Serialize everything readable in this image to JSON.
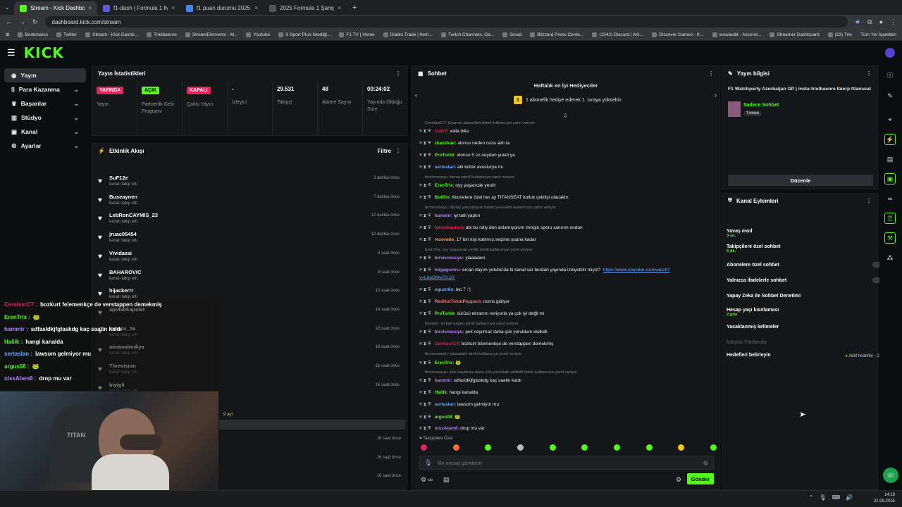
{
  "browser": {
    "tabs": [
      {
        "title": "Stream - Kick Dashboard",
        "color": "#53fc18"
      },
      {
        "title": "f1-dash | Formula 1 live timing",
        "color": "#5b5bd6"
      },
      {
        "title": "f1 puan durumu 2025 - Google",
        "color": "#4285f4"
      },
      {
        "title": "2025 Formula 1 Şampiyonası Yarış",
        "color": "#555555"
      }
    ],
    "url": "dashboard.kick.com/stream",
    "bookmarks": [
      "Bookmarks",
      "Twitter",
      "Stream - Kick Dashb...",
      "Trielbaenre",
      "StreamElements - M...",
      "Youtube",
      "S Sport Plus-İstediği...",
      "F1 TV | Home",
      "Diablo Trade | Item...",
      "Twitch Channels, Ga...",
      "Gmail",
      "Blizzard Press Cente...",
      "(1342) Discord | Ark...",
      "Discover Games - K...",
      "wowaudit - Ascend...",
      "Streamer Dashboard",
      "(23) Trielbaenre - Yo..."
    ],
    "all_bookmarks": "Tüm Yer İşaretleri"
  },
  "logo": "KICK",
  "sidebar": {
    "items": [
      {
        "label": "Yayın",
        "icon": "stream-icon"
      },
      {
        "label": "Para Kazanma",
        "icon": "dollar-icon"
      },
      {
        "label": "Başarılar",
        "icon": "trophy-icon"
      },
      {
        "label": "Stüdyo",
        "icon": "studio-icon"
      },
      {
        "label": "Kanal",
        "icon": "channel-icon"
      },
      {
        "label": "Ayarlar",
        "icon": "gear-icon"
      }
    ]
  },
  "stats": {
    "title": "Yayın İstatistikleri",
    "cells": [
      {
        "value": "YAYINDA",
        "label": "Yayın",
        "badge": "#e0245e"
      },
      {
        "value": "AÇIK",
        "label": "Partnerlik Gelir Programı",
        "badge": "#53fc18"
      },
      {
        "value": "KAPALI",
        "label": "Çoklu Yayın",
        "badge": "#e0245e"
      },
      {
        "value": "-",
        "label": "İzleyici"
      },
      {
        "value": "29.531",
        "label": "Takipçi"
      },
      {
        "value": "48",
        "label": "Abone Sayısı"
      },
      {
        "value": "00:24:02",
        "label": "Yayında Olduğu Süre"
      }
    ]
  },
  "activity": {
    "title": "Etkinlik Akışı",
    "filter": "Filtre",
    "events": [
      {
        "name": "SuF12e",
        "sub": "kanalı takip etti",
        "time": "3 dakika önce"
      },
      {
        "name": "Buseaynen",
        "sub": "kanalı takip etti",
        "time": "7 dakika önce"
      },
      {
        "name": "LebRonCAYMIS_23",
        "sub": "kanalı takip etti",
        "time": "12 dakika önce"
      },
      {
        "name": "jruac05454",
        "sub": "kanalı takip etti",
        "time": "12 dakika önce"
      },
      {
        "name": "Vividazai",
        "sub": "kanalı takip etti",
        "time": "4 saat önce"
      },
      {
        "name": "BAHAROVIC",
        "sub": "kanalı takip etti",
        "time": "8 saat önce"
      },
      {
        "name": "hijackerrr",
        "sub": "kanalı takip etti",
        "time": "10 saat önce"
      },
      {
        "name": "apolatikapolet",
        "sub": "",
        "time": "14 saat önce"
      },
      {
        "name": "iremsu_16",
        "sub": "kanalı takip etti",
        "time": "16 saat önce"
      },
      {
        "name": "aimanaimdiya",
        "sub": "kanalı takip etti",
        "time": "16 saat önce"
      },
      {
        "name": "Threvision",
        "sub": "kanalı takip etti",
        "time": "16 saat önce"
      },
      {
        "name": "biyigli",
        "sub": "kanalı takip etti",
        "time": "16 saat önce"
      }
    ],
    "extra_times": [
      "16 saat önce",
      "16 saat önce",
      "16 saat önce",
      "16 saat önce"
    ],
    "months": "9 ay!"
  },
  "overlay_chat": [
    {
      "user": "CerelaxrC7 :",
      "msg": "bozkurt felemenkçe de verstappen demekmiş",
      "color": "#e0245e"
    },
    {
      "user": "ErenTrix :",
      "msg": "🐸",
      "color": "#53fc18"
    },
    {
      "user": "hammir :",
      "msg": "sdfasldkjfglaskdg kaç saatin kaldı",
      "color": "#b57cff"
    },
    {
      "user": "Halilk :",
      "msg": "hangi kanalda",
      "color": "#53fc18"
    },
    {
      "user": "sertaslan :",
      "msg": "lawsom gelmiyor mu",
      "color": "#6ba8ff"
    },
    {
      "user": "argus08 :",
      "msg": "🐸",
      "color": "#53fc18"
    },
    {
      "user": "nissAben8 :",
      "msg": "drop mu var",
      "color": "#b57cff"
    }
  ],
  "chat": {
    "title": "Sohbet",
    "gifter_title": "Haftalık en İyi Hediyeciler",
    "gifter_rank": "1",
    "gifter_text": "1 abonelik hediye ederek 1. sıraya yükseltin",
    "lines": [
      {
        "type": "reply",
        "text": "CerelaxrC7: kıyamet alametleri isimli kullanıcıya yanıt veriyor"
      },
      {
        "type": "msg",
        "user": "ztatz7",
        "msg": "valla bilia",
        "color": "#e0245e"
      },
      {
        "type": "msg",
        "user": "zkanzkan",
        "msg": "alonso neden ceza aldı ta",
        "color": "#53fc18"
      },
      {
        "type": "msg",
        "user": "ProTurkk",
        "msg": "alonso 5 sn neyden yuedi ya",
        "color": "#53fc18"
      },
      {
        "type": "msg",
        "user": "sertaslan",
        "msg": "abi kütük avusturya mı",
        "color": "#6ba8ff"
      },
      {
        "type": "reply",
        "text": "birvisnesuyu: borsa isimli kullanıcıya yanıt veriyor"
      },
      {
        "type": "msg",
        "user": "ErenTrix",
        "msg": "oyy yaşancak yerdir",
        "color": "#53fc18"
      },
      {
        "type": "msg",
        "user": "BotRix",
        "msg": "Abonelere özel her ay TITANSEAT koltuk çekilişi olacaktır.",
        "color": "#53fc18"
      },
      {
        "type": "reply",
        "text": "birvisnesuyu: dünüş yolundayım balım yea isimli kullanıcıya yanıt veriyor"
      },
      {
        "type": "msg",
        "user": "hammir",
        "msg": "iyi tatil yaptın",
        "color": "#b57cff"
      },
      {
        "type": "msg",
        "user": "tanenbaumm",
        "msg": "abi bu rally den anlamıyorum zengin sporu sanırım ondan",
        "color": "#e0245e"
      },
      {
        "type": "msg",
        "user": "rezoredo",
        "msg": "17 bin kişi katılmış seçime şuana kadar",
        "color": "#ff9f40"
      },
      {
        "type": "reply",
        "text": "ErenTrix: oyy yaşancak yerdir isimli kullanıcıya yanıt veriyor"
      },
      {
        "type": "msg",
        "user": "birvisnesuyu",
        "msg": "yiaaaaani",
        "color": "#b57cff"
      },
      {
        "type": "msg",
        "user": "toigagumru",
        "msg": "ercan dayım yotube'da bi kanal var burdan yayında izleyebilir miyiz?",
        "link": "https://www.youtube.com/watch?",
        "color": "#b57cff"
      },
      {
        "type": "link2",
        "text": "v=L6aOMwTIUJY"
      },
      {
        "type": "msg",
        "user": "oguzn6o",
        "msg": "lec 7 :')",
        "color": "#6ba8ff"
      },
      {
        "type": "msg",
        "user": "RedHotTokatPeppers",
        "msg": "norris gidiyor",
        "color": "#ff6b6b"
      },
      {
        "type": "msg",
        "user": "ProTurkk",
        "msg": "sürücü ekranını veriyorla ya çok iyi değil mi",
        "color": "#53fc18"
      },
      {
        "type": "reply",
        "text": "hammir: iyi tatil yaptın isimli kullanıcıya yanıt veriyor"
      },
      {
        "type": "msg",
        "user": "birvisnesuyu",
        "msg": "pek sayılmaz daha çok yoruldum xkdkdk",
        "color": "#b57cff"
      },
      {
        "type": "msg",
        "user": "CerelaxrC7",
        "msg": "bozkurt felemenkçe de verstappen demekmiş",
        "color": "#e0245e"
      },
      {
        "type": "reply",
        "text": "birvisnesuyu: yiaaaaani isimli kullanıcıya yanıt veriyor"
      },
      {
        "type": "msg",
        "user": "ErenTrix",
        "msg": "🐸",
        "color": "#53fc18"
      },
      {
        "type": "reply",
        "text": "birvisnesuyu: pek sayılmaz daha çok yoruldum xkdkdk isimli kullanıcıya yanıt veriyor"
      },
      {
        "type": "msg",
        "user": "hammir",
        "msg": "sdfasldkjfglaskdg kaç saatin kaldı",
        "color": "#b57cff"
      },
      {
        "type": "msg",
        "user": "Halilk",
        "msg": "hangi kanalda",
        "color": "#53fc18"
      },
      {
        "type": "msg",
        "user": "sertaslan",
        "msg": "lawsom gelmiyor mu",
        "color": "#6ba8ff"
      },
      {
        "type": "msg",
        "user": "argus08",
        "msg": "🐸",
        "color": "#53fc18"
      },
      {
        "type": "msg",
        "user": "nissAben8",
        "msg": "drop mu var",
        "color": "#b57cff"
      }
    ],
    "followers_only": "Takipçilere Özel",
    "placeholder": "Bir mesaj gönderin",
    "send": "Gönder"
  },
  "stream_info": {
    "title": "Yayın bilgisi",
    "stream_title": "F1 Watchparty Azerbaijan GP | insta:trielbaenre lbierp lttanseat",
    "category": "Sadece Sohbet",
    "tag": "Türkish",
    "edit": "Düzenle"
  },
  "channel_actions": {
    "title": "Kanal Eylemleri",
    "items": [
      {
        "label": "Yavaş mod",
        "sub": "3 sn.",
        "control": "chevron"
      },
      {
        "label": "Takipçilere özel sohbet",
        "sub": "6 dk.",
        "control": "chevron"
      },
      {
        "label": "Abonelere özel sohbet",
        "sub": "",
        "control": "toggle"
      },
      {
        "label": "Yalnızca ifadelerle sohbet",
        "sub": "",
        "control": "toggle"
      },
      {
        "label": "Yapay Zeka ile Sohbet Denetimi",
        "sub": "",
        "control": "external"
      },
      {
        "label": "Hesap yaşı kısıtlaması",
        "sub": "2 gün",
        "control": "chevron"
      },
      {
        "label": "Yasaklanmış kelimeler",
        "sub": "",
        "control": "chevron"
      },
      {
        "label": "İzleyici Yönlendir",
        "sub": "",
        "control": "disabled"
      },
      {
        "label": "Hedefleri belirleyin",
        "sub": "",
        "control": "goal"
      }
    ],
    "goal_text": "Aktif hedefler - 2"
  },
  "taskbar": {
    "time": "14:18",
    "date": "21.09.2025"
  }
}
